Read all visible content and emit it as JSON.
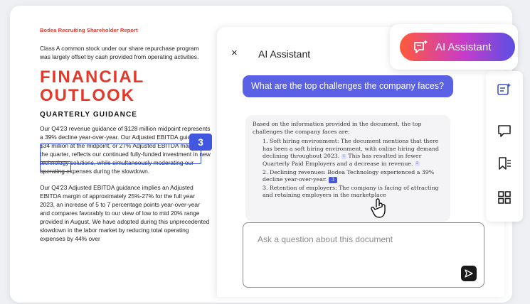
{
  "document": {
    "header": "Bodea Recruiting Shareholder Report",
    "intro": "Class A common stock under our share repurchase program was largely offset by cash provided from operating activities.",
    "title_line1": "FINANCIAL",
    "title_line2": "OUTLOOK",
    "section_heading": "QUARTERLY GUIDANCE",
    "guidance_p1": "Our Q4'23 revenue guidance of $128 million midpoint represents a 39% decline year-over-year. Our Adjusted EBITDA guidance of $34 million at the midpoint, or 27% Adjusted EBITDA margin, for the quarter, reflects our continued fully-funded investment in new technology solutions, while simultaneously moderating our operating expenses during the slowdown.",
    "guidance_p2": "Our Q4'23 Adjusted EBITDA guidance implies an Adjusted EBITDA margin of approximately 25%-27% for the full year 2023, an increase of 5 to 7 percentage points year-over-year and compares favorably to our view of low to mid 20% range provided in August. We have adopted during this unprecedented slowdown in the labor market by reducing total operating expenses by 44% over",
    "highlight_badge": "3"
  },
  "assistant": {
    "close_label": "×",
    "title": "AI Assistant",
    "question": "What are the top challenges the company faces?",
    "answer_intro": "Based on the information provided in the document, the top challenges the company faces are:",
    "items": [
      {
        "number": "1.",
        "text": "Soft hiring environment: The document mentions that there has been a soft hiring environment, with online hiring demand declining throughout 2023.",
        "cite1": "1",
        "after": " This has resulted in fewer Quarterly Paid Employers and a decrease in revenue.",
        "cite2": "2"
      },
      {
        "number": "2.",
        "text": "Declining revenues: Bodea Technology experienced a 39% decline year-over-year.",
        "cite": "3"
      },
      {
        "number": "3.",
        "text": "Retention of employers: The company is facing of attracting and retaining employers in the marketplace"
      }
    ],
    "input_placeholder": "Ask a question about this document",
    "send_icon": "send-icon"
  },
  "pill": {
    "label": "AI Assistant",
    "icon": "ai-assistant-icon"
  },
  "rail": {
    "icons": [
      "ai-summary-icon",
      "comment-icon",
      "bookmark-list-icon",
      "grid-apps-icon"
    ]
  },
  "colors": {
    "brand_red": "#e4382a",
    "assistant_purple": "#5b61e4",
    "highlight_blue": "#4257e0"
  }
}
